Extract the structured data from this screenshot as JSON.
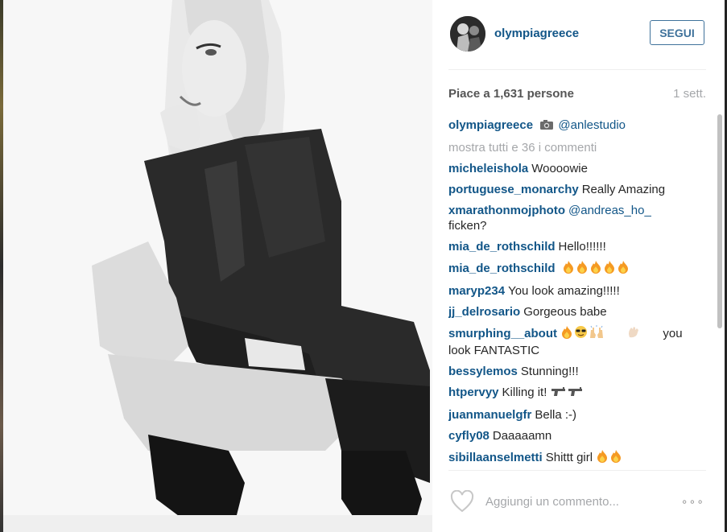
{
  "post": {
    "username": "olympiagreece",
    "follow_label": "SEGUI",
    "likes_text": "Piace a 1,631 persone",
    "time_ago": "1 sett.",
    "caption": {
      "user": "olympiagreece",
      "camera_icon": "camera-icon",
      "mention": "@anlestudio"
    },
    "show_all_text": "mostra tutti e 36 i commenti",
    "comments": [
      {
        "user": "micheleishola",
        "text": "Woooowie"
      },
      {
        "user": "portuguese_monarchy",
        "text": "Really Amazing"
      },
      {
        "user": "xmarathonmojphoto",
        "mention": "@andreas_ho_",
        "text": "ficken?"
      },
      {
        "user": "mia_de_rothschild",
        "text": "Hello!!!!!!"
      },
      {
        "user": "mia_de_rothschild",
        "emoji": "fire-emoji x5"
      },
      {
        "user": "maryp234",
        "text": "You look amazing!!!!!"
      },
      {
        "user": "jj_delrosario",
        "text": "Gorgeous babe"
      },
      {
        "user": "smurphing__about",
        "emoji": "fire, sunglasses-face, raised-hands, waving-hand",
        "text": "you look FANTASTIC"
      },
      {
        "user": "bessylemos",
        "text": "Stunning!!!"
      },
      {
        "user": "htpervyy",
        "text": "Killing it!",
        "emoji": "pistol x2"
      },
      {
        "user": "juanmanuelgfr",
        "text": "Bella :-)"
      },
      {
        "user": "cyfly08",
        "text": "Daaaaamn"
      },
      {
        "user": "sibillaanselmetti",
        "text": "Shittt girl",
        "emoji": "fire x2"
      }
    ],
    "add_comment_placeholder": "Aggiungi un commento...",
    "more_label": "∘∘∘"
  },
  "colors": {
    "link": "#125688",
    "follow_border": "#3f729b",
    "muted": "#a5a7aa"
  }
}
